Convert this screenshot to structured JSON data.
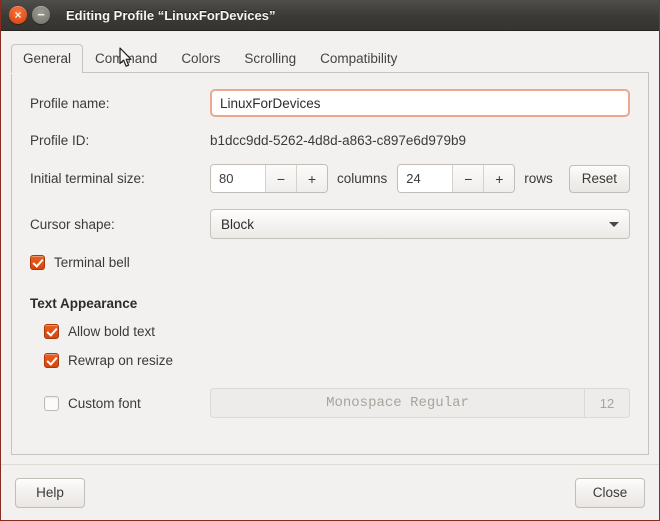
{
  "window": {
    "title": "Editing Profile “LinuxForDevices”",
    "close_glyph": "×",
    "minimize_glyph": "−",
    "accent_color": "#dd4814",
    "titlebar_color": "#3b3a37"
  },
  "tabs": [
    {
      "label": "General",
      "active": true
    },
    {
      "label": "Command",
      "active": false
    },
    {
      "label": "Colors",
      "active": false
    },
    {
      "label": "Scrolling",
      "active": false
    },
    {
      "label": "Compatibility",
      "active": false
    }
  ],
  "general": {
    "profile_name_label": "Profile name:",
    "profile_name_value": "LinuxForDevices",
    "profile_id_label": "Profile ID:",
    "profile_id_value": "b1dcc9dd-5262-4d8d-a863-c897e6d979b9",
    "terminal_size_label": "Initial terminal size:",
    "columns_value": "80",
    "columns_unit": "columns",
    "rows_value": "24",
    "rows_unit": "rows",
    "minus_glyph": "−",
    "plus_glyph": "+",
    "reset_label": "Reset",
    "cursor_shape_label": "Cursor shape:",
    "cursor_shape_value": "Block",
    "terminal_bell_label": "Terminal bell",
    "terminal_bell_checked": true,
    "text_appearance_title": "Text Appearance",
    "allow_bold_label": "Allow bold text",
    "allow_bold_checked": true,
    "rewrap_label": "Rewrap on resize",
    "rewrap_checked": true,
    "custom_font_label": "Custom font",
    "custom_font_checked": false,
    "font_name": "Monospace Regular",
    "font_size": "12"
  },
  "actions": {
    "help_label": "Help",
    "close_label": "Close"
  }
}
